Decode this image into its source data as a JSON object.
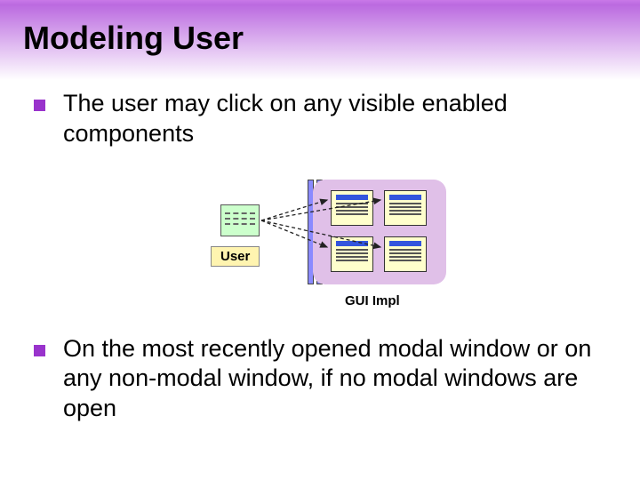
{
  "title": "Modeling User",
  "bullets": [
    "The user may click on any visible enabled components",
    "On the most recently opened modal window or on any non-modal window, if no modal windows are open"
  ],
  "diagram": {
    "user_label": "User",
    "gui_label": "GUI Impl"
  }
}
